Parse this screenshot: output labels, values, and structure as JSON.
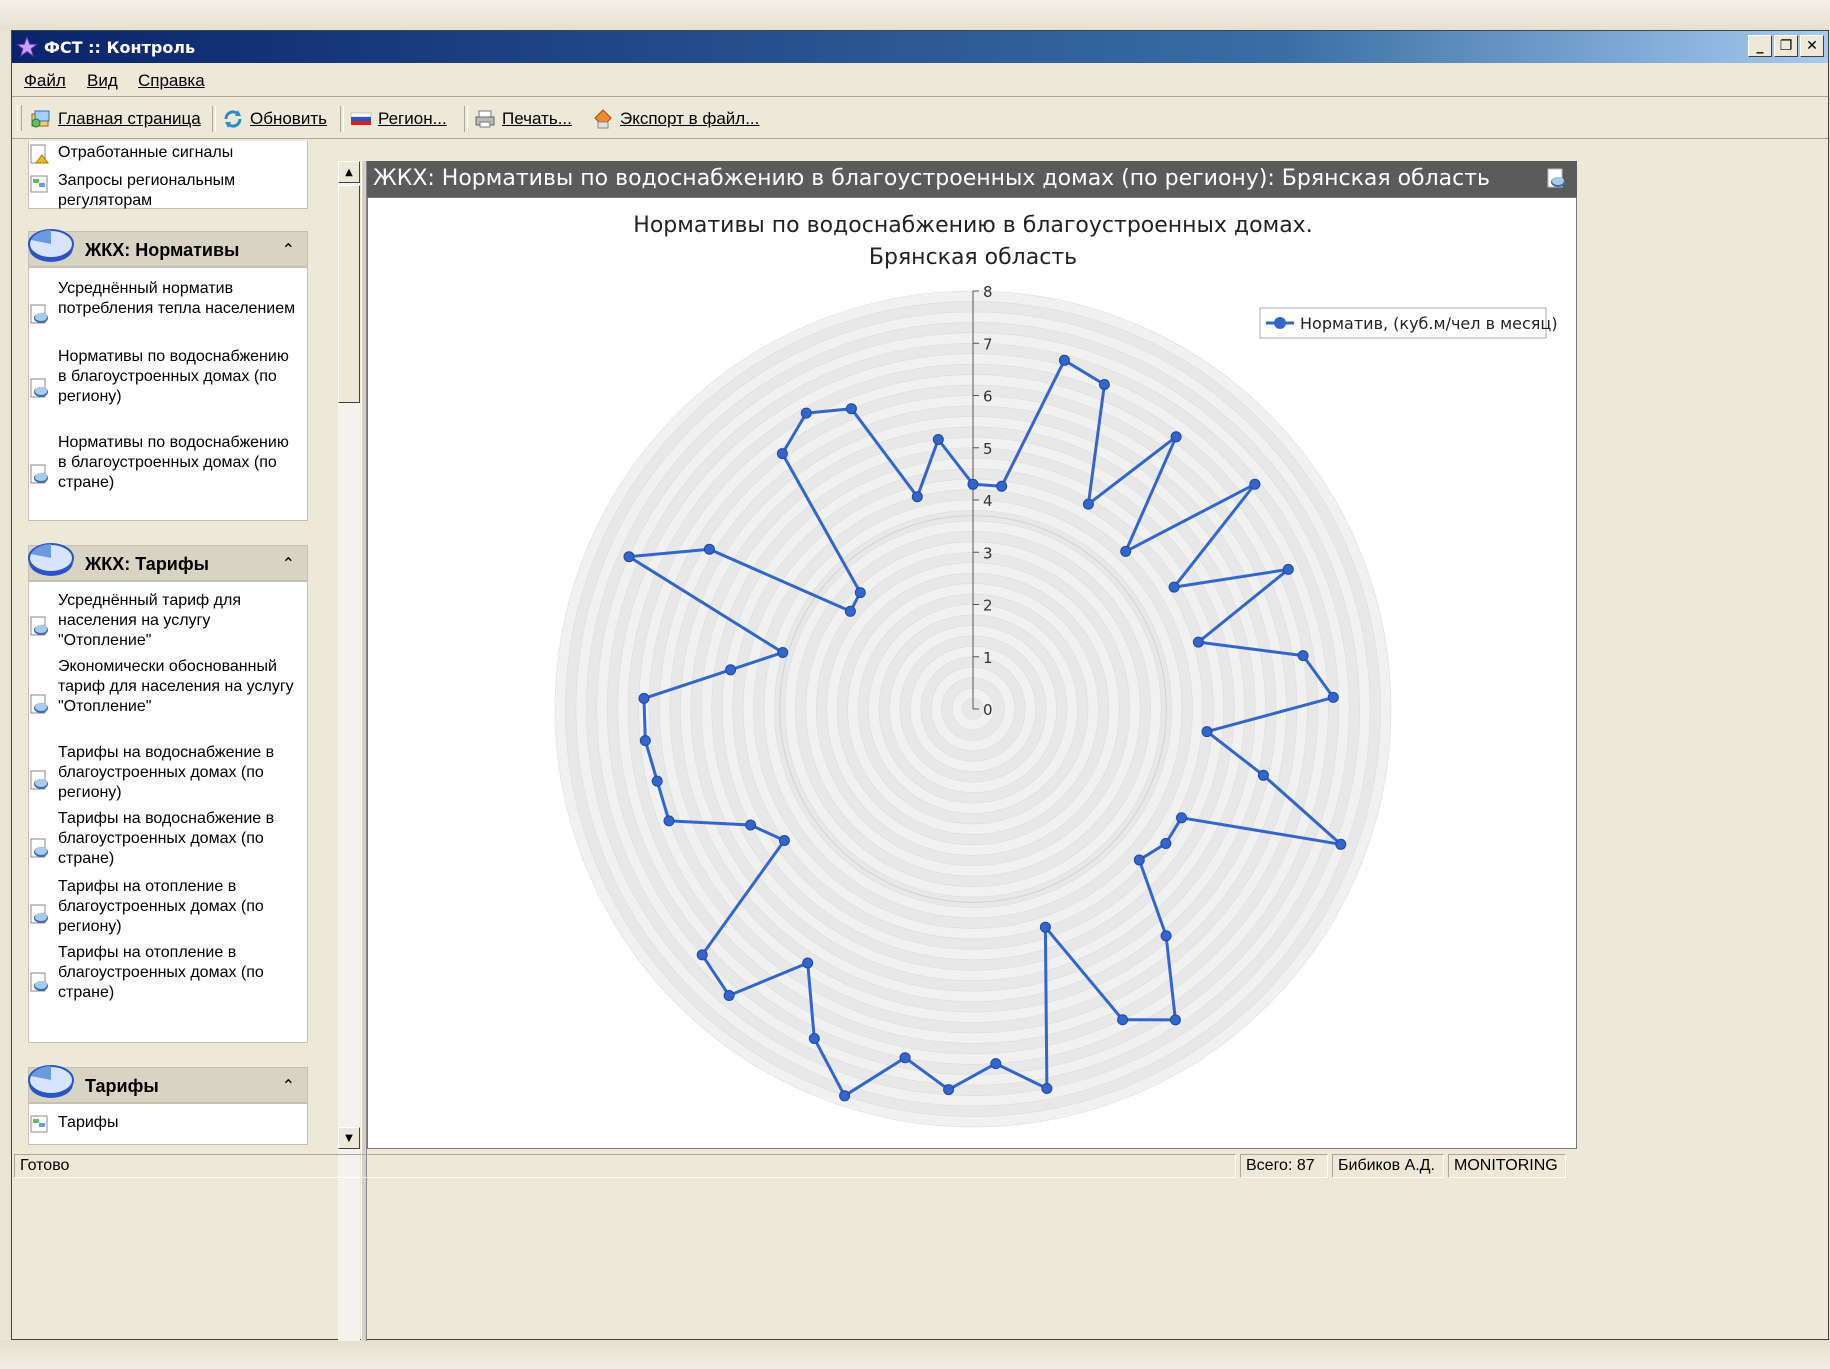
{
  "window": {
    "title": "ФСТ :: Контроль"
  },
  "menu": {
    "file": "Файл",
    "view": "Вид",
    "help": "Справка"
  },
  "toolbar": {
    "home": "Главная страница",
    "refresh": "Обновить",
    "region": "Регион...",
    "print": "Печать...",
    "export": "Экспорт в файл..."
  },
  "sidebar": {
    "top_items": [
      "Отработанные сигналы",
      "Запросы региональным регуляторам"
    ],
    "groups": [
      {
        "title": "ЖКХ: Нормативы",
        "items": [
          "Усреднённый норматив потребления тепла населением",
          "Нормативы по водоснабжению в благоустроенных домах (по региону)",
          "Нормативы по водоснабжению в благоустроенных домах (по стране)"
        ]
      },
      {
        "title": "ЖКХ: Тарифы",
        "items": [
          "Усреднённый тариф для населения на услугу \"Отопление\"",
          "Экономически обоснованный тариф для населения на услугу \"Отопление\"",
          "Тарифы на водоснабжение в благоустроенных домах (по региону)",
          "Тарифы на водоснабжение в благоустроенных домах (по стране)",
          "Тарифы на отопление в благоустроенных домах (по региону)",
          "Тарифы на отопление в благоустроенных домах (по стране)"
        ]
      },
      {
        "title": "Тарифы",
        "items": [
          "Тарифы"
        ]
      }
    ]
  },
  "main": {
    "header": "ЖКХ: Нормативы по водоснабжению в благоустроенных домах (по региону): Брянская область"
  },
  "status": {
    "ready": "Готово",
    "total": "Всего: 87",
    "user": "Бибиков А.Д.",
    "mode": "MONITORING"
  },
  "colors": {
    "series": "#3366cc",
    "titlebar": "#0a246a",
    "header": "#5b5b5b"
  },
  "chart_data": {
    "type": "radar",
    "title": "Нормативы по водоснабжению в благоустроенных домах.",
    "subtitle": "Брянская область",
    "legend_position": "top-right",
    "rlim": [
      0,
      8
    ],
    "r_ticks": [
      0,
      1,
      2,
      3,
      4,
      5,
      6,
      7,
      8
    ],
    "series": [
      {
        "name": "Норматив, (куб.м/чел в месяц)",
        "values": [
          4.3,
          4.3,
          6.9,
          6.7,
          4.5,
          6.5,
          4.2,
          6.9,
          4.5,
          6.6,
          4.5,
          6.4,
          6.9,
          4.5,
          5.7,
          7.5,
          4.5,
          4.5,
          4.3,
          5.7,
          7.1,
          6.6,
          4.4,
          7.4,
          6.8,
          7.3,
          6.8,
          7.8,
          7.0,
          5.8,
          7.2,
          7.0,
          4.4,
          4.8,
          6.2,
          6.2,
          6.3,
          6.3,
          4.7,
          3.8,
          7.2,
          5.9,
          3.0,
          3.1,
          6.1,
          6.5,
          6.2,
          4.2,
          5.2
        ]
      }
    ]
  }
}
